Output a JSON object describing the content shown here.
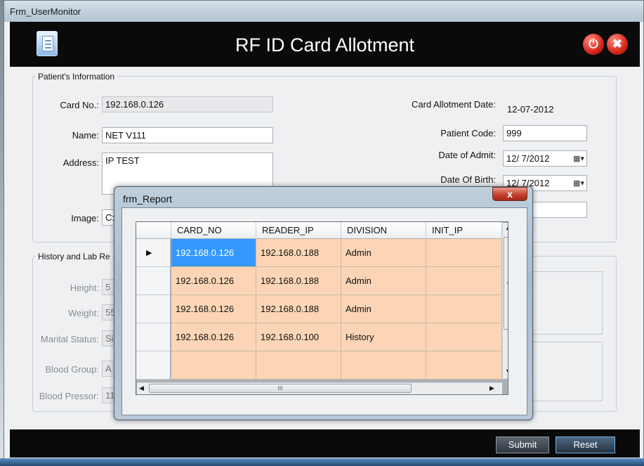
{
  "window": {
    "title": "Frm_UserMonitor"
  },
  "header": {
    "title": "RF ID Card Allotment",
    "power_icon": "power-icon",
    "close_icon": "close-icon"
  },
  "patient": {
    "group_label": "Patient's Information",
    "card_no_label": "Card No.:",
    "card_no": "192.168.0.126",
    "name_label": "Name:",
    "name": "NET V111",
    "address_label": "Address:",
    "address": "IP TEST",
    "image_label": "Image:",
    "image": "C:",
    "card_allot_date_label": "Card Allotment Date:",
    "card_allot_date": "12-07-2012",
    "patient_code_label": "Patient Code:",
    "patient_code": "999",
    "date_admit_label": "Date of Admit:",
    "date_admit": "12/ 7/2012",
    "dob_label": "Date Of Birth:",
    "dob": "12/ 7/2012"
  },
  "history": {
    "group_label": "History and Lab Re",
    "height_label": "Height:",
    "height": "5",
    "weight_label": "Weight:",
    "weight": "55",
    "marital_label": "Marital Status:",
    "marital": "Si",
    "blood_group_label": "Blood Group:",
    "blood_group": "A",
    "blood_pressor_label": "Blood Pressor:",
    "blood_pressor": "11"
  },
  "footer": {
    "submit": "Submit",
    "reset": "Reset"
  },
  "dialog": {
    "title": "frm_Report",
    "close_label": "x",
    "columns": [
      "CARD_NO",
      "READER_IP",
      "DIVISION",
      "INIT_IP"
    ],
    "rows": [
      [
        "192.168.0.126",
        "192.168.0.188",
        "Admin",
        ""
      ],
      [
        "192.168.0.126",
        "192.168.0.188",
        "Admin",
        ""
      ],
      [
        "192.168.0.126",
        "192.168.0.188",
        "Admin",
        ""
      ],
      [
        "192.168.0.126",
        "192.168.0.100",
        "History",
        ""
      ]
    ],
    "current_row_marker": "▶",
    "hscroll_grip": "III"
  },
  "colors": {
    "header_bg": "#0a0a0a",
    "row_bg": "#fbd5b5",
    "selected_cell": "#3399ff"
  }
}
